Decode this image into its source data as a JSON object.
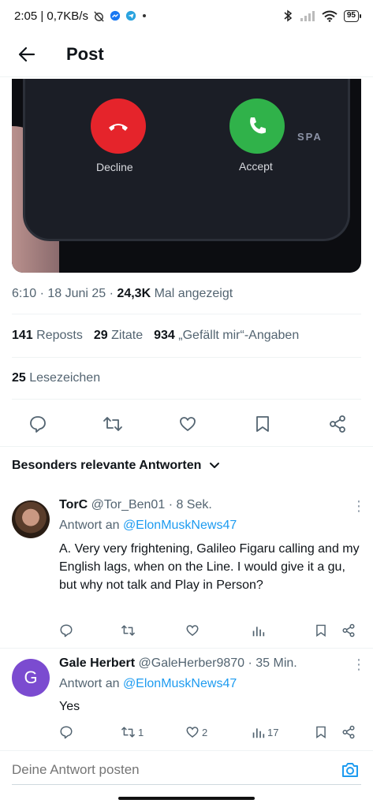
{
  "status_bar": {
    "time_network": "2:05 | 0,7KB/s",
    "battery": "95"
  },
  "header": {
    "title": "Post"
  },
  "media": {
    "decline_label": "Decline",
    "accept_label": "Accept",
    "brand_text": "SPA"
  },
  "post_meta": {
    "time_date": "6:10 · 18 Juni 25 ·",
    "views_count": "24,3K",
    "views_label": "Mal angezeigt"
  },
  "stats": {
    "reposts_count": "141",
    "reposts_label": "Reposts",
    "quotes_count": "29",
    "quotes_label": "Zitate",
    "likes_count": "934",
    "likes_label": "„Gefällt mir“-Angaben",
    "bookmarks_count": "25",
    "bookmarks_label": "Lesezeichen"
  },
  "sort": {
    "label": "Besonders relevante Antworten"
  },
  "replies": [
    {
      "name": "TorC",
      "handle": "@Tor_Ben01",
      "time": "· 8 Sek.",
      "reply_to_label": "Antwort an",
      "reply_to_handle": "@ElonMuskNews47",
      "text": "A. Very very frightening, Galileo Figaru calling and my English lags, when on the Line. I would give it a gu, but why not talk and Play in Person?",
      "reposts": "",
      "likes": "",
      "views": ""
    },
    {
      "name": "Gale Herbert",
      "handle": "@GaleHerber9870",
      "time": "· 35 Min.",
      "avatar_letter": "G",
      "reply_to_label": "Antwort an",
      "reply_to_handle": "@ElonMuskNews47",
      "text": "Yes",
      "reposts": "1",
      "likes": "2",
      "views": "17"
    }
  ],
  "compose": {
    "placeholder": "Deine Antwort posten"
  },
  "colors": {
    "accent": "#1d9bf0",
    "decline": "#e5242b",
    "accept": "#30b24a",
    "avatar_g": "#7b4bd0"
  }
}
